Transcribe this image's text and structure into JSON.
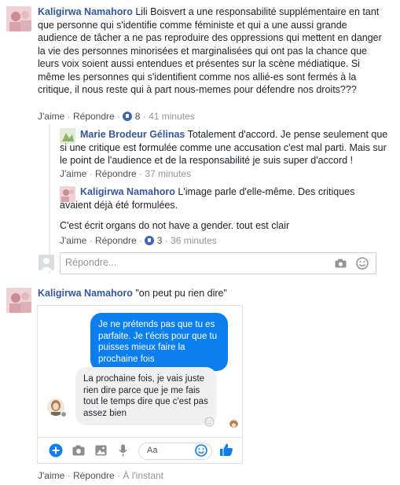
{
  "thread": {
    "top_comment": {
      "author": "Kaligirwa Namahoro",
      "text": "Lili Boisvert a une responsabilité supplémentaire en tant que personne qui s'identifie comme féministe et qui a une aussi grande audience de tâcher a ne pas reproduire des oppressions qui mettent en danger la vie des personnes minorisées et marginalisées qui ont pas la chance que leurs voix soient aussi entendues et présentes sur la scène médiatique. Si même les personnes qui s'identifient comme nos allié-es sont fermés à la critique, il nous reste qui à part nous-memes pour défendre nos droits???",
      "like": "J'aime",
      "reply": "Répondre",
      "reactions": "8",
      "time": "41 minutes"
    },
    "replies": [
      {
        "author": "Marie Brodeur Gélinas",
        "text": "Totalement d'accord. Je pense seulement que si une critique est formulée comme une accusation c'est mal parti. Mais sur le point de l'audience et de la responsabilité je suis super d'accord !",
        "like": "J'aime",
        "reply": "Répondre",
        "time": "37 minutes"
      },
      {
        "author": "Kaligirwa Namahoro",
        "text": "L'image parle d'elle-même. Des critiques avaient déjà été formulées.",
        "text2": "C'est écrit organs do not have a gender. tout est clair",
        "like": "J'aime",
        "reply": "Répondre",
        "reactions": "3",
        "time": "36 minutes"
      }
    ],
    "reply_placeholder": "Répondre...",
    "second_comment": {
      "author": "Kaligirwa Namahoro",
      "text": "\"on peut pu rien dire\"",
      "like": "J'aime",
      "reply": "Répondre",
      "time": "À l'instant"
    }
  },
  "messenger": {
    "sent_message": "Je ne prétends pas que tu es parfaite. Je t'écris pour que tu puisses mieux faire la prochaine fois",
    "received_message": "La prochaine fois, je vais juste rien dire parce que je me fais tout le temps dire que c'est pas assez bien",
    "input_placeholder": "Aa"
  },
  "colors": {
    "link": "#365899",
    "messenger_blue": "#0b7ff0",
    "like_blue": "#4267b2",
    "meta_grey": "#90949c"
  }
}
